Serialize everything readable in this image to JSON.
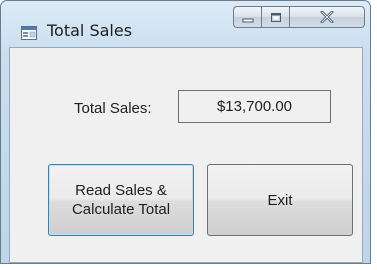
{
  "window": {
    "title": "Total Sales",
    "app_icon": "form-icon",
    "caption_buttons": [
      "minimize-icon",
      "maximize-icon",
      "close-icon"
    ]
  },
  "form": {
    "total_label": "Total Sales:",
    "total_value": "$13,700.00",
    "read_button_label": "Read Sales &\nCalculate Total",
    "exit_button_label": "Exit"
  },
  "colors": {
    "title_gradient_top": "#dcebf6",
    "title_gradient_bottom": "#bdd5ea",
    "client_bg": "#f0f0f0",
    "focused_button_border": "#3c7fb1"
  }
}
